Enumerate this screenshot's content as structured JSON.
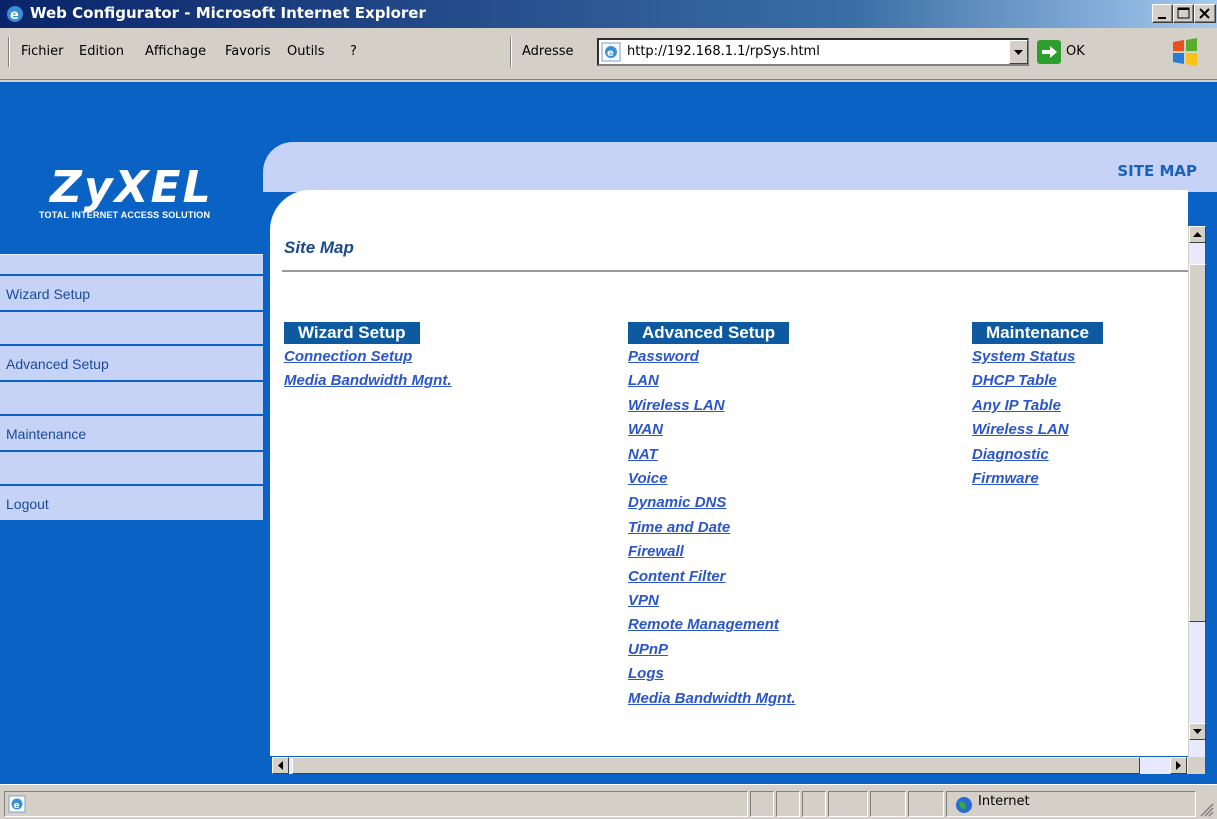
{
  "window": {
    "title": "Web Configurator - Microsoft Internet Explorer"
  },
  "menubar": {
    "items": [
      "Fichier",
      "Edition",
      "Affichage",
      "Favoris",
      "Outils",
      "?"
    ],
    "address_label": "Adresse",
    "url": "http://192.168.1.1/rpSys.html",
    "go_label": "OK"
  },
  "brand": {
    "logo": "ZyXEL",
    "tagline": "TOTAL INTERNET ACCESS SOLUTION",
    "header_title": "SITE MAP"
  },
  "sidebar": {
    "items": [
      "Wizard Setup",
      "Advanced Setup",
      "Maintenance",
      "Logout"
    ]
  },
  "content": {
    "title": "Site Map",
    "columns": [
      {
        "heading": "Wizard Setup",
        "links": [
          "Connection Setup",
          "Media Bandwidth Mgnt."
        ]
      },
      {
        "heading": "Advanced Setup",
        "links": [
          "Password",
          "LAN",
          "Wireless LAN",
          "WAN",
          "NAT",
          "Voice",
          "Dynamic DNS",
          "Time and Date",
          "Firewall",
          "Content Filter",
          "VPN",
          "Remote Management",
          "UPnP",
          "Logs",
          "Media Bandwidth Mgnt."
        ]
      },
      {
        "heading": "Maintenance",
        "links": [
          "System Status",
          "DHCP Table",
          "Any IP Table",
          "Wireless LAN",
          "Diagnostic",
          "Firmware"
        ]
      }
    ]
  },
  "statusbar": {
    "zone": "Internet"
  },
  "colors": {
    "brand_blue": "#0a63c4",
    "panel_light": "#c6d3f6",
    "link": "#2a56c8",
    "heading_bg": "#0d5aa0"
  }
}
